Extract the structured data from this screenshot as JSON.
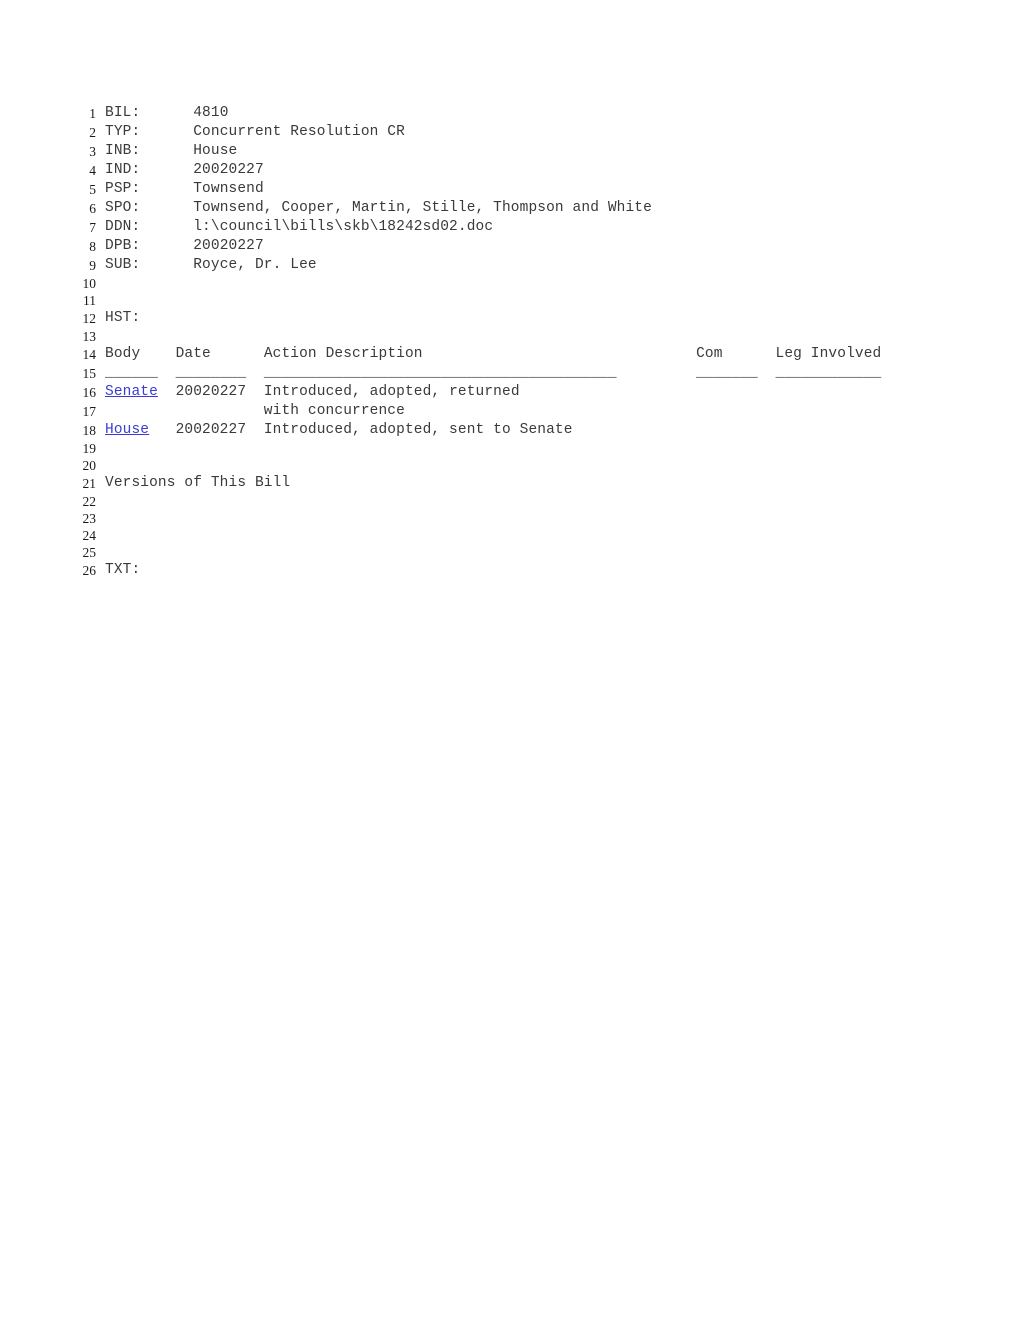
{
  "document": {
    "type": "legislative-bill-record",
    "text_color": "#3a3a3a",
    "link_color": "#3b3bd6",
    "background": "#ffffff",
    "fields": {
      "bil_label": "BIL:",
      "bil_value": "4810",
      "typ_label": "TYP:",
      "typ_value": "Concurrent Resolution CR",
      "inb_label": "INB:",
      "inb_value": "House",
      "ind_label": "IND:",
      "ind_value": "20020227",
      "psp_label": "PSP:",
      "psp_value": "Townsend",
      "spo_label": "SPO:",
      "spo_value": "Townsend, Cooper, Martin, Stille, Thompson and White",
      "ddn_label": "DDN:",
      "ddn_value": "l:\\council\\bills\\skb\\18242sd02.doc",
      "dpb_label": "DPB:",
      "dpb_value": "20020227",
      "sub_label": "SUB:",
      "sub_value": "Royce, Dr. Lee"
    },
    "history": {
      "section_label": "HST:",
      "columns": {
        "body": "Body",
        "date": "Date",
        "action": "Action Description",
        "com": "Com",
        "leg": "Leg Involved"
      },
      "rules": {
        "body": "______",
        "date": "________",
        "action": "________________________________________",
        "com": "_______",
        "leg": "____________"
      },
      "rows": [
        {
          "body": "Senate",
          "body_is_link": true,
          "date": "20020227",
          "action": "Introduced, adopted, returned",
          "action_cont": "with concurrence",
          "com": "",
          "leg": ""
        },
        {
          "body": "House",
          "body_is_link": true,
          "date": "20020227",
          "action": "Introduced, adopted, sent to Senate",
          "action_cont": "",
          "com": "",
          "leg": ""
        }
      ]
    },
    "versions_heading": "Versions of This Bill",
    "txt_label": "TXT:",
    "line_numbers": [
      "1",
      "2",
      "3",
      "4",
      "5",
      "6",
      "7",
      "8",
      "9",
      "10",
      "11",
      "12",
      "13",
      "14",
      "15",
      "16",
      "17",
      "18",
      "19",
      "20",
      "21",
      "22",
      "23",
      "24",
      "25",
      "26"
    ]
  }
}
